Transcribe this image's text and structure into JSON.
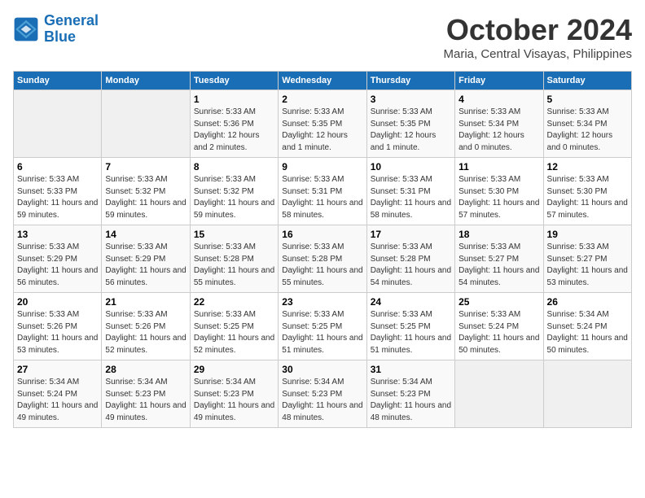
{
  "header": {
    "logo_line1": "General",
    "logo_line2": "Blue",
    "month": "October 2024",
    "location": "Maria, Central Visayas, Philippines"
  },
  "weekdays": [
    "Sunday",
    "Monday",
    "Tuesday",
    "Wednesday",
    "Thursday",
    "Friday",
    "Saturday"
  ],
  "weeks": [
    [
      {
        "day": "",
        "sunrise": "",
        "sunset": "",
        "daylight": ""
      },
      {
        "day": "",
        "sunrise": "",
        "sunset": "",
        "daylight": ""
      },
      {
        "day": "1",
        "sunrise": "Sunrise: 5:33 AM",
        "sunset": "Sunset: 5:36 PM",
        "daylight": "Daylight: 12 hours and 2 minutes."
      },
      {
        "day": "2",
        "sunrise": "Sunrise: 5:33 AM",
        "sunset": "Sunset: 5:35 PM",
        "daylight": "Daylight: 12 hours and 1 minute."
      },
      {
        "day": "3",
        "sunrise": "Sunrise: 5:33 AM",
        "sunset": "Sunset: 5:35 PM",
        "daylight": "Daylight: 12 hours and 1 minute."
      },
      {
        "day": "4",
        "sunrise": "Sunrise: 5:33 AM",
        "sunset": "Sunset: 5:34 PM",
        "daylight": "Daylight: 12 hours and 0 minutes."
      },
      {
        "day": "5",
        "sunrise": "Sunrise: 5:33 AM",
        "sunset": "Sunset: 5:34 PM",
        "daylight": "Daylight: 12 hours and 0 minutes."
      }
    ],
    [
      {
        "day": "6",
        "sunrise": "Sunrise: 5:33 AM",
        "sunset": "Sunset: 5:33 PM",
        "daylight": "Daylight: 11 hours and 59 minutes."
      },
      {
        "day": "7",
        "sunrise": "Sunrise: 5:33 AM",
        "sunset": "Sunset: 5:32 PM",
        "daylight": "Daylight: 11 hours and 59 minutes."
      },
      {
        "day": "8",
        "sunrise": "Sunrise: 5:33 AM",
        "sunset": "Sunset: 5:32 PM",
        "daylight": "Daylight: 11 hours and 59 minutes."
      },
      {
        "day": "9",
        "sunrise": "Sunrise: 5:33 AM",
        "sunset": "Sunset: 5:31 PM",
        "daylight": "Daylight: 11 hours and 58 minutes."
      },
      {
        "day": "10",
        "sunrise": "Sunrise: 5:33 AM",
        "sunset": "Sunset: 5:31 PM",
        "daylight": "Daylight: 11 hours and 58 minutes."
      },
      {
        "day": "11",
        "sunrise": "Sunrise: 5:33 AM",
        "sunset": "Sunset: 5:30 PM",
        "daylight": "Daylight: 11 hours and 57 minutes."
      },
      {
        "day": "12",
        "sunrise": "Sunrise: 5:33 AM",
        "sunset": "Sunset: 5:30 PM",
        "daylight": "Daylight: 11 hours and 57 minutes."
      }
    ],
    [
      {
        "day": "13",
        "sunrise": "Sunrise: 5:33 AM",
        "sunset": "Sunset: 5:29 PM",
        "daylight": "Daylight: 11 hours and 56 minutes."
      },
      {
        "day": "14",
        "sunrise": "Sunrise: 5:33 AM",
        "sunset": "Sunset: 5:29 PM",
        "daylight": "Daylight: 11 hours and 56 minutes."
      },
      {
        "day": "15",
        "sunrise": "Sunrise: 5:33 AM",
        "sunset": "Sunset: 5:28 PM",
        "daylight": "Daylight: 11 hours and 55 minutes."
      },
      {
        "day": "16",
        "sunrise": "Sunrise: 5:33 AM",
        "sunset": "Sunset: 5:28 PM",
        "daylight": "Daylight: 11 hours and 55 minutes."
      },
      {
        "day": "17",
        "sunrise": "Sunrise: 5:33 AM",
        "sunset": "Sunset: 5:28 PM",
        "daylight": "Daylight: 11 hours and 54 minutes."
      },
      {
        "day": "18",
        "sunrise": "Sunrise: 5:33 AM",
        "sunset": "Sunset: 5:27 PM",
        "daylight": "Daylight: 11 hours and 54 minutes."
      },
      {
        "day": "19",
        "sunrise": "Sunrise: 5:33 AM",
        "sunset": "Sunset: 5:27 PM",
        "daylight": "Daylight: 11 hours and 53 minutes."
      }
    ],
    [
      {
        "day": "20",
        "sunrise": "Sunrise: 5:33 AM",
        "sunset": "Sunset: 5:26 PM",
        "daylight": "Daylight: 11 hours and 53 minutes."
      },
      {
        "day": "21",
        "sunrise": "Sunrise: 5:33 AM",
        "sunset": "Sunset: 5:26 PM",
        "daylight": "Daylight: 11 hours and 52 minutes."
      },
      {
        "day": "22",
        "sunrise": "Sunrise: 5:33 AM",
        "sunset": "Sunset: 5:25 PM",
        "daylight": "Daylight: 11 hours and 52 minutes."
      },
      {
        "day": "23",
        "sunrise": "Sunrise: 5:33 AM",
        "sunset": "Sunset: 5:25 PM",
        "daylight": "Daylight: 11 hours and 51 minutes."
      },
      {
        "day": "24",
        "sunrise": "Sunrise: 5:33 AM",
        "sunset": "Sunset: 5:25 PM",
        "daylight": "Daylight: 11 hours and 51 minutes."
      },
      {
        "day": "25",
        "sunrise": "Sunrise: 5:33 AM",
        "sunset": "Sunset: 5:24 PM",
        "daylight": "Daylight: 11 hours and 50 minutes."
      },
      {
        "day": "26",
        "sunrise": "Sunrise: 5:34 AM",
        "sunset": "Sunset: 5:24 PM",
        "daylight": "Daylight: 11 hours and 50 minutes."
      }
    ],
    [
      {
        "day": "27",
        "sunrise": "Sunrise: 5:34 AM",
        "sunset": "Sunset: 5:24 PM",
        "daylight": "Daylight: 11 hours and 49 minutes."
      },
      {
        "day": "28",
        "sunrise": "Sunrise: 5:34 AM",
        "sunset": "Sunset: 5:23 PM",
        "daylight": "Daylight: 11 hours and 49 minutes."
      },
      {
        "day": "29",
        "sunrise": "Sunrise: 5:34 AM",
        "sunset": "Sunset: 5:23 PM",
        "daylight": "Daylight: 11 hours and 49 minutes."
      },
      {
        "day": "30",
        "sunrise": "Sunrise: 5:34 AM",
        "sunset": "Sunset: 5:23 PM",
        "daylight": "Daylight: 11 hours and 48 minutes."
      },
      {
        "day": "31",
        "sunrise": "Sunrise: 5:34 AM",
        "sunset": "Sunset: 5:23 PM",
        "daylight": "Daylight: 11 hours and 48 minutes."
      },
      {
        "day": "",
        "sunrise": "",
        "sunset": "",
        "daylight": ""
      },
      {
        "day": "",
        "sunrise": "",
        "sunset": "",
        "daylight": ""
      }
    ]
  ]
}
